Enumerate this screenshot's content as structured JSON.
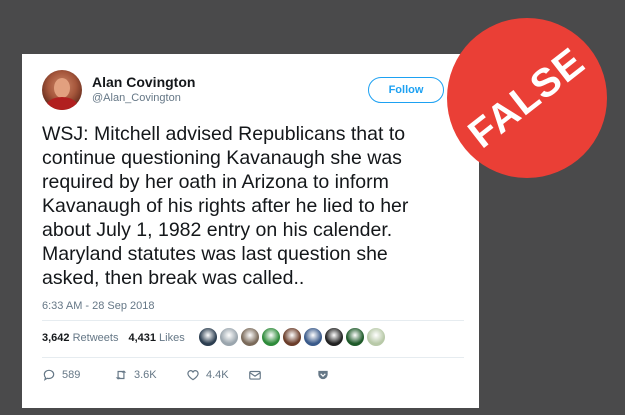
{
  "tweet": {
    "author_name": "Alan Covington",
    "author_handle": "@Alan_Covington",
    "follow_label": "Follow",
    "text": "WSJ: Mitchell advised Republicans that to\ncontinue questioning Kavanaugh she was\nrequired by her oath in Arizona to inform\nKavanaugh of his rights after he lied to her\nabout July 1, 1982 entry on his calender.\nMaryland statutes was last question she\nasked, then break was called..",
    "timestamp": "6:33 AM - 28 Sep 2018"
  },
  "stats": {
    "retweets_count": "3,642",
    "retweets_label": "Retweets",
    "likes_count": "4,431",
    "likes_label": "Likes"
  },
  "likers": [
    {
      "icon": "avatar",
      "color": "#2c3e50"
    },
    {
      "icon": "avatar",
      "color": "#9aa5ad"
    },
    {
      "icon": "avatar",
      "color": "#7a6a5a"
    },
    {
      "icon": "avatar",
      "color": "#2e8b3a"
    },
    {
      "icon": "avatar",
      "color": "#6b3d2a"
    },
    {
      "icon": "avatar",
      "color": "#3a5a8a"
    },
    {
      "icon": "avatar",
      "color": "#222222"
    },
    {
      "icon": "avatar",
      "color": "#1f5a2a"
    },
    {
      "icon": "avatar",
      "color": "#b8c9a8"
    }
  ],
  "actions": {
    "replies": "589",
    "retweets": "3.6K",
    "likes": "4.4K"
  },
  "badge": {
    "text": "FALSE",
    "color": "#ea3f36"
  }
}
